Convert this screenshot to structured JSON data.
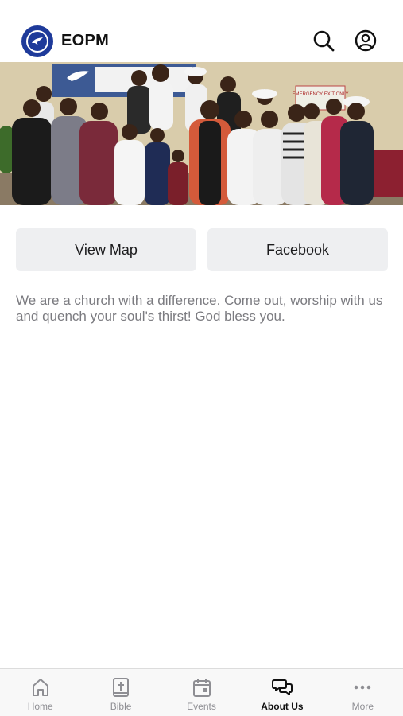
{
  "header": {
    "title": "EOPM",
    "logo_icon": "dove-logo-icon",
    "search_icon": "search-icon",
    "account_icon": "account-icon"
  },
  "hero": {
    "image": "church-group-photo",
    "sign_text": "EMERGENCY EXIT ONLY"
  },
  "actions": {
    "view_map_label": "View Map",
    "facebook_label": "Facebook"
  },
  "description": "We are a church with a difference. Come out, worship with us and quench your soul's thirst! God bless you.",
  "tabs": [
    {
      "label": "Home",
      "icon": "home-icon",
      "active": false
    },
    {
      "label": "Bible",
      "icon": "bible-icon",
      "active": false
    },
    {
      "label": "Events",
      "icon": "calendar-icon",
      "active": false
    },
    {
      "label": "About Us",
      "icon": "chat-bubbles-icon",
      "active": true
    },
    {
      "label": "More",
      "icon": "more-dots-icon",
      "active": false
    }
  ],
  "colors": {
    "brand": "#1e3a9a",
    "button_bg": "#eeeff1",
    "text_muted": "#7b7b80",
    "tab_inactive": "#8e8e93"
  }
}
